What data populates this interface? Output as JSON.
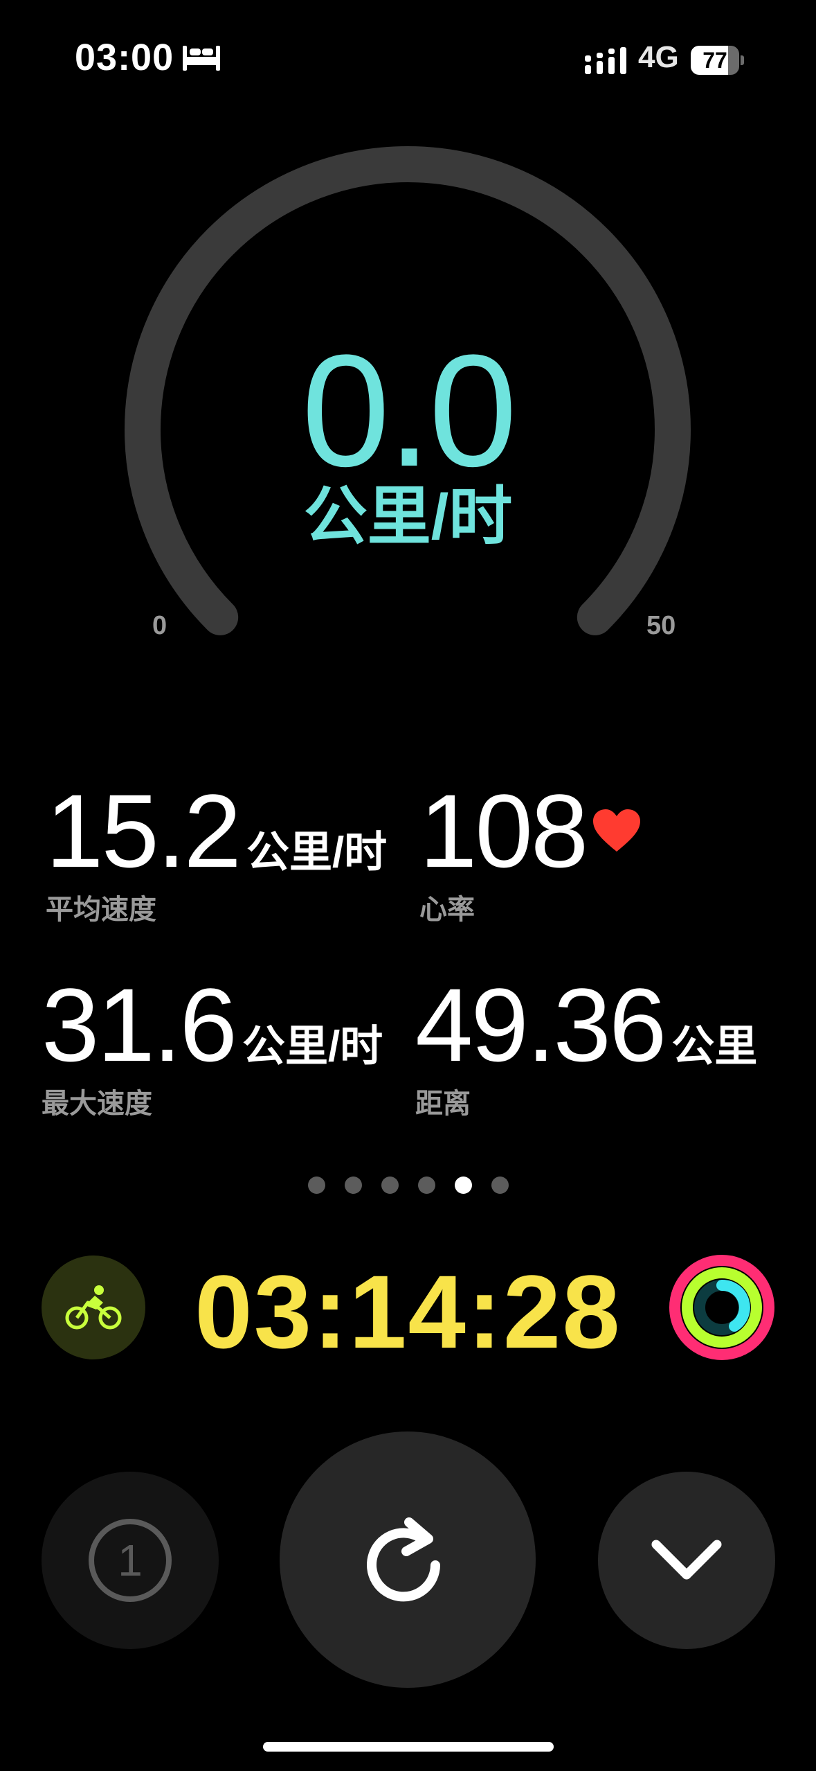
{
  "status_bar": {
    "time": "03:00",
    "network": "4G",
    "battery": "77",
    "battery_fraction": 0.77,
    "icons": [
      "bed-icon",
      "signal-icon",
      "battery-icon"
    ]
  },
  "gauge": {
    "value": "0.0",
    "unit": "公里/时",
    "min_label": "0",
    "max_label": "50",
    "min": 0,
    "max": 50,
    "current": 0.0,
    "track_color": "#3a3a3a",
    "accent_color": "#6fe3dd"
  },
  "metrics": {
    "avg_speed": {
      "value": "15.2",
      "unit": "公里/时",
      "label": "平均速度"
    },
    "heart_rate": {
      "value": "108",
      "label": "心率",
      "icon": "heart-icon",
      "icon_color": "#ff3b30"
    },
    "max_speed": {
      "value": "31.6",
      "unit": "公里/时",
      "label": "最大速度"
    },
    "distance": {
      "value": "49.36",
      "unit": "公里",
      "label": "距离"
    }
  },
  "pager": {
    "count": 6,
    "active_index": 4
  },
  "workout": {
    "icon": "cycling-icon",
    "icon_color": "#c8ff3c",
    "elapsed": "03:14:28",
    "elapsed_color": "#f8e34a",
    "rings_icon": "activity-rings-icon"
  },
  "controls": {
    "segment": {
      "icon": "segment-one-icon",
      "label": "1"
    },
    "resume": {
      "icon": "resume-arrow-icon"
    },
    "collapse": {
      "icon": "chevron-down-icon"
    }
  }
}
